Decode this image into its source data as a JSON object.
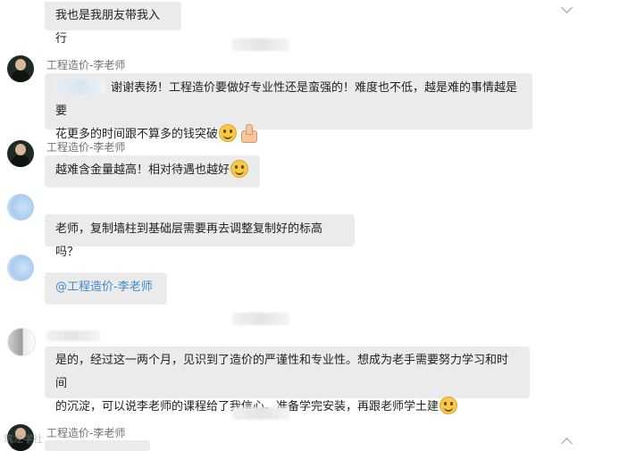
{
  "messages": [
    {
      "text": "我也是我朋友带我入行"
    },
    {
      "sender": "工程造价-李老师",
      "text_line1": "谢谢表扬！工程造价要做好专业性还是蛮强的！难度也不低，越是难的事情越是要",
      "text_line2": "花更多的时间跟不算多的钱突破"
    },
    {
      "sender": "工程造价-李老师",
      "text": "越难含金量越高！相对待遇也越好"
    },
    {
      "text": "老师，复制墙柱到基础层需要再去调整复制好的标高吗？"
    },
    {
      "text": "@工程造价-李老师"
    },
    {
      "text_line1": "是的，经过这一两个月，见识到了造价的严谨性和专业性。想成为老手需要努力学习和时间",
      "text_line2": "的沉淀，可以说李老师的课程给了我信心。准备学完安装，再跟老师学土建"
    },
    {
      "sender": "工程造价-李老师"
    }
  ],
  "watermark": "筑龙学社",
  "icons": [
    "smile-emoji-icon",
    "thumbs-up-emoji-icon",
    "chevron-icon"
  ]
}
